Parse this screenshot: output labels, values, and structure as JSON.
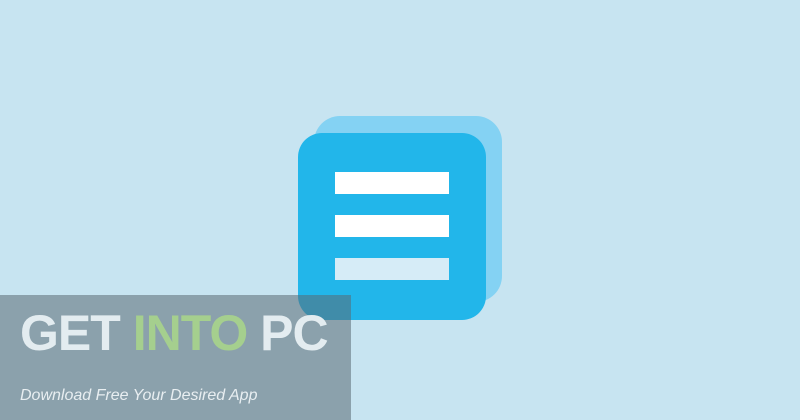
{
  "background_color": "#c7e4f1",
  "app_icon": {
    "icon": "hamburger-menu-icon",
    "front_color": "#22b6ea",
    "back_color": "#84d2f3",
    "bar_color": "#ffffff"
  },
  "watermark": {
    "title_parts": [
      "GET",
      "INTO",
      "PC"
    ],
    "title_colors": [
      "#e3ecf0",
      "#a5cf8e",
      "#e3ecf0"
    ],
    "tagline": "Download Free Your Desired App"
  }
}
